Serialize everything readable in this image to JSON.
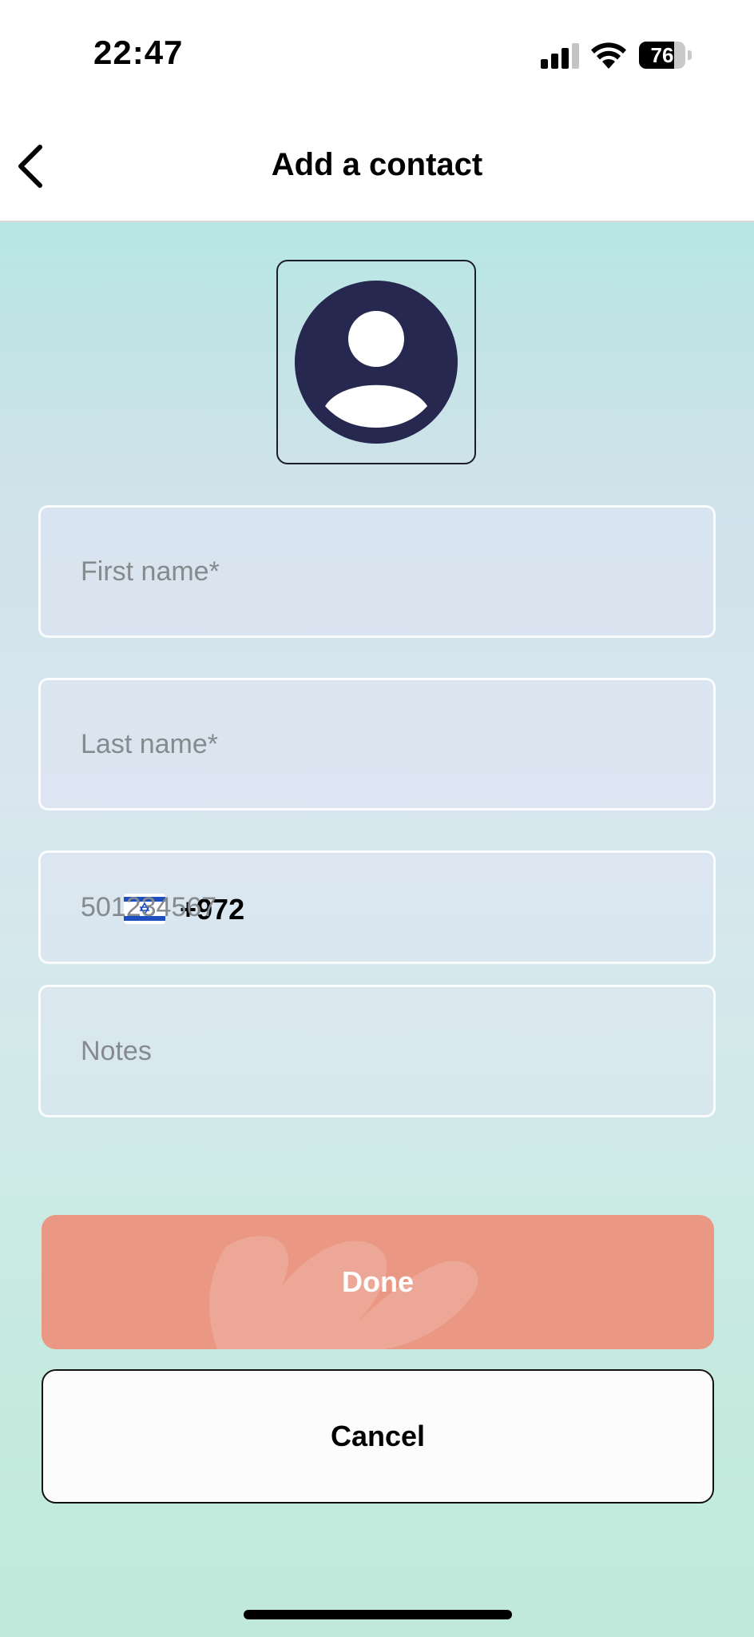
{
  "status_bar": {
    "time": "22:47",
    "battery_percent": "76",
    "battery_level": 0.76,
    "icons": [
      "cellular-signal-icon",
      "wifi-icon",
      "battery-icon"
    ]
  },
  "header": {
    "title": "Add a contact",
    "back_icon": "chevron-left-icon"
  },
  "avatar": {
    "icon": "user-avatar-icon"
  },
  "form": {
    "first_name": {
      "value": "",
      "placeholder": "First name*"
    },
    "last_name": {
      "value": "",
      "placeholder": "Last name*"
    },
    "phone": {
      "country_flag": "israel-flag-icon",
      "dial_code": "+972",
      "value": "",
      "placeholder": "501234567"
    },
    "notes": {
      "value": "",
      "placeholder": "Notes"
    }
  },
  "actions": {
    "done_label": "Done",
    "cancel_label": "Cancel"
  },
  "colors": {
    "accent": "#ea9783",
    "avatar": "#262850",
    "background_top": "#b7e6e4",
    "background_bottom": "#bfe9db"
  }
}
